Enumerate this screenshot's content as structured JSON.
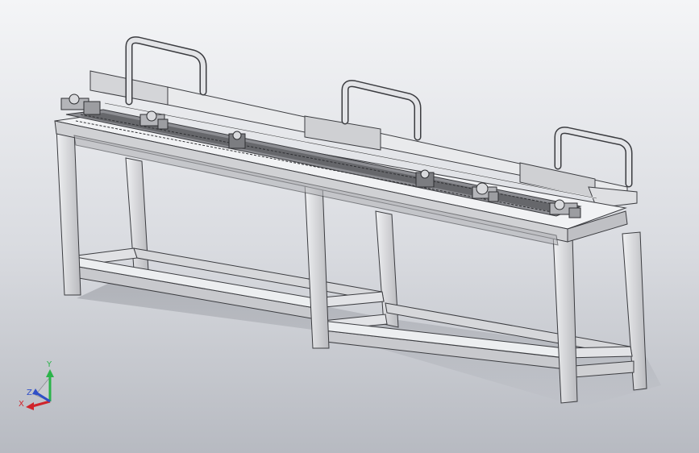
{
  "scene": {
    "subject": "conveyor-workbench-3d-model",
    "background": {
      "top": "#f4f5f7",
      "bottom": "#b7bac1"
    },
    "colors": {
      "frame_light": "#e6e7e9",
      "frame_mid": "#c9cace",
      "frame_dark": "#9a9ba0",
      "edge": "#3b3c40",
      "rail": "#6b6c70",
      "shadow": "#7d8087"
    }
  },
  "triad": {
    "y_label": "Y",
    "z_label": "Z",
    "x_label": "X",
    "y_color": "#2bb34a",
    "x_color": "#d0242b",
    "z_color": "#2f4fc7"
  }
}
